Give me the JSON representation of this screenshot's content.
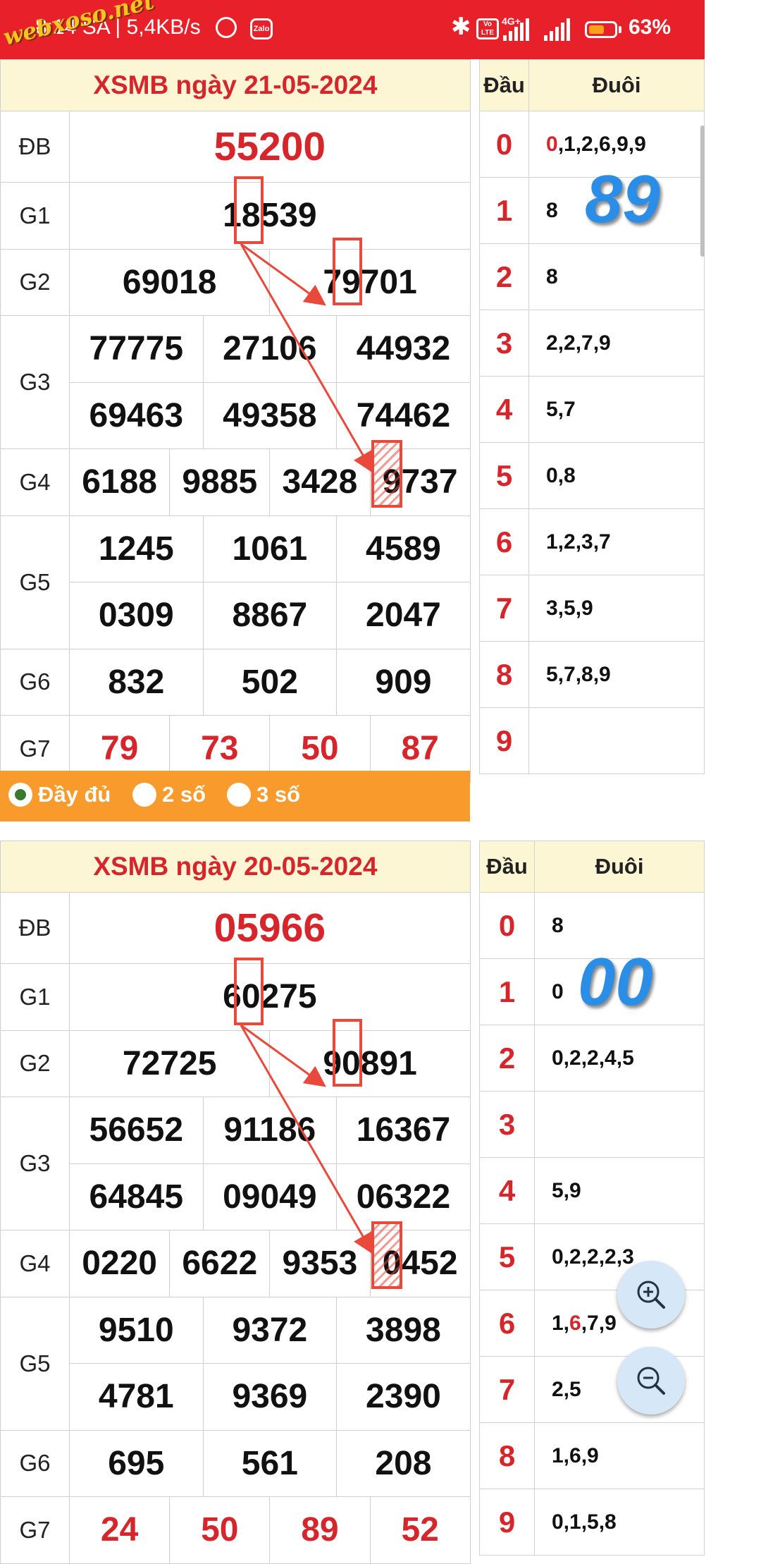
{
  "status_bar": {
    "time": "8:14 SA | 5,4KB/s",
    "zalo": "Zalo",
    "volte": "Vo LTE",
    "network": "4G+",
    "battery": "63%",
    "battery_level": 0.63,
    "watermark": "webxoso.net"
  },
  "results": [
    {
      "title": "XSMB ngày 21-05-2024",
      "labels": {
        "db": "ĐB",
        "g1": "G1",
        "g2": "G2",
        "g3": "G3",
        "g4": "G4",
        "g5": "G5",
        "g6": "G6",
        "g7": "G7"
      },
      "db": "55200",
      "g1": "18539",
      "g2": [
        "69018",
        "79701"
      ],
      "g3": [
        "77775",
        "27106",
        "44932",
        "69463",
        "49358",
        "74462"
      ],
      "g4": [
        "6188",
        "9885",
        "3428",
        "9737"
      ],
      "g5": [
        "1245",
        "1061",
        "4589",
        "0309",
        "8867",
        "2047"
      ],
      "g6": [
        "832",
        "502",
        "909"
      ],
      "g7": [
        "79",
        "73",
        "50",
        "87"
      ],
      "annotation": "89",
      "dau_header": "Đầu",
      "duoi_header": "Đuôi",
      "dau_duoi": [
        {
          "dau": "0",
          "duoi_red": "0",
          "duoi": ",1,2,6,9,9"
        },
        {
          "dau": "1",
          "duoi_red": "",
          "duoi": "8"
        },
        {
          "dau": "2",
          "duoi_red": "",
          "duoi": "8"
        },
        {
          "dau": "3",
          "duoi_red": "",
          "duoi": "2,2,7,9"
        },
        {
          "dau": "4",
          "duoi_red": "",
          "duoi": "5,7"
        },
        {
          "dau": "5",
          "duoi_red": "",
          "duoi": "0,8"
        },
        {
          "dau": "6",
          "duoi_red": "",
          "duoi": "1,2,3,7"
        },
        {
          "dau": "7",
          "duoi_red": "",
          "duoi": "3,5,9"
        },
        {
          "dau": "8",
          "duoi_red": "",
          "duoi": "5,7,8,9"
        },
        {
          "dau": "9",
          "duoi_red": "",
          "duoi": ""
        }
      ]
    },
    {
      "title": "XSMB ngày 20-05-2024",
      "labels": {
        "db": "ĐB",
        "g1": "G1",
        "g2": "G2",
        "g3": "G3",
        "g4": "G4",
        "g5": "G5",
        "g6": "G6",
        "g7": "G7"
      },
      "db": "05966",
      "g1": "60275",
      "g2": [
        "72725",
        "90891"
      ],
      "g3": [
        "56652",
        "91186",
        "16367",
        "64845",
        "09049",
        "06322"
      ],
      "g4": [
        "0220",
        "6622",
        "9353",
        "0452"
      ],
      "g5": [
        "9510",
        "9372",
        "3898",
        "4781",
        "9369",
        "2390"
      ],
      "g6": [
        "695",
        "561",
        "208"
      ],
      "g7": [
        "24",
        "50",
        "89",
        "52"
      ],
      "annotation": "00",
      "dau_header": "Đầu",
      "duoi_header": "Đuôi",
      "dau_duoi": [
        {
          "dau": "0",
          "duoi_pre": "",
          "duoi_red": "",
          "duoi": "8"
        },
        {
          "dau": "1",
          "duoi_pre": "",
          "duoi_red": "",
          "duoi": "0"
        },
        {
          "dau": "2",
          "duoi_pre": "",
          "duoi_red": "",
          "duoi": "0,2,2,4,5"
        },
        {
          "dau": "3",
          "duoi_pre": "",
          "duoi_red": "",
          "duoi": ""
        },
        {
          "dau": "4",
          "duoi_pre": "",
          "duoi_red": "",
          "duoi": "5,9"
        },
        {
          "dau": "5",
          "duoi_pre": "",
          "duoi_red": "",
          "duoi": "0,2,2,2,3"
        },
        {
          "dau": "6",
          "duoi_pre": "1,",
          "duoi_red": "6",
          "duoi": ",7,9"
        },
        {
          "dau": "7",
          "duoi_pre": "",
          "duoi_red": "",
          "duoi": "2,5"
        },
        {
          "dau": "8",
          "duoi_pre": "",
          "duoi_red": "",
          "duoi": "1,6,9"
        },
        {
          "dau": "9",
          "duoi_pre": "",
          "duoi_red": "",
          "duoi": "0,1,5,8"
        }
      ]
    }
  ],
  "options": {
    "full": "Đầy đủ",
    "two": "2 số",
    "three": "3 số"
  },
  "colors": {
    "accent_red": "#d6262c",
    "orange_bar": "#f89a2c",
    "header_bg": "#fdf6d5",
    "annotation_blue": "#2b8ee6"
  }
}
